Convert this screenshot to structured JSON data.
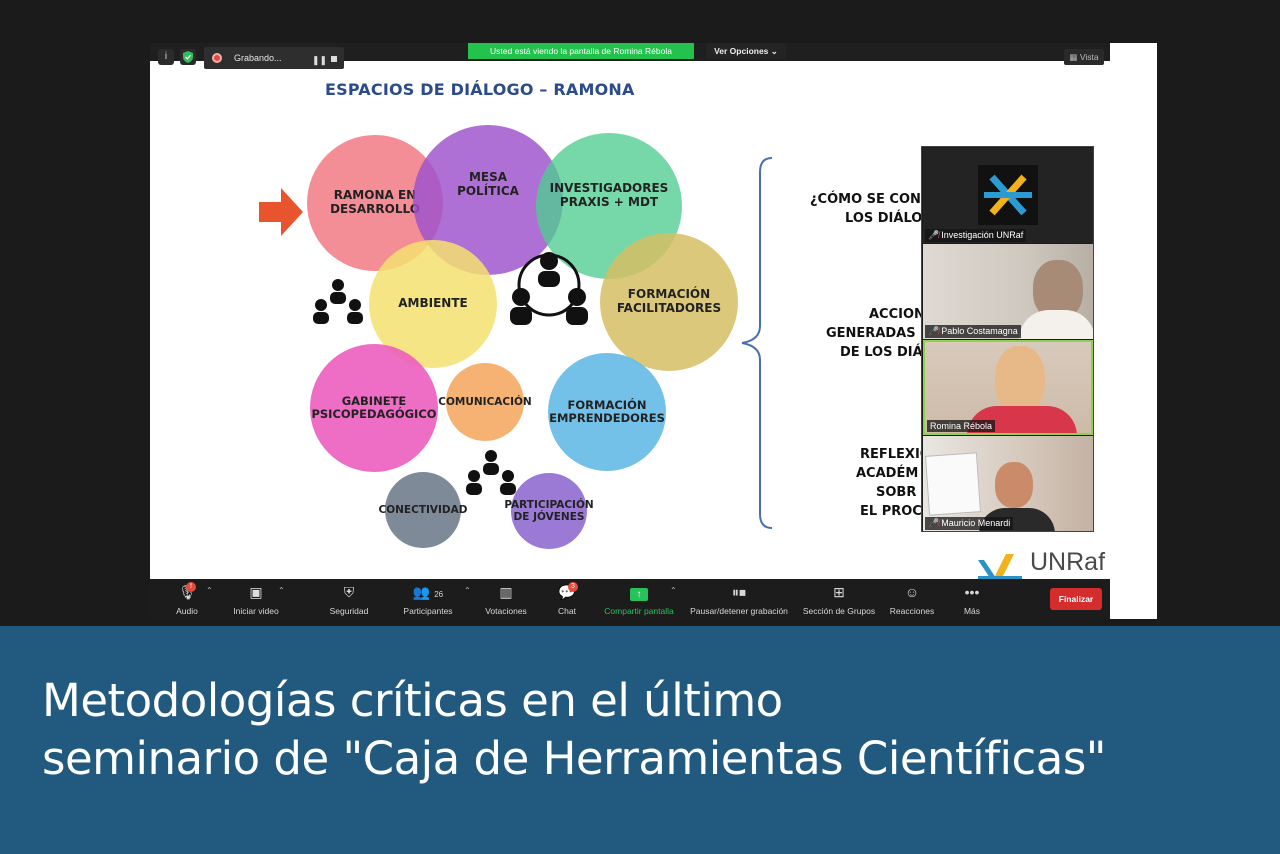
{
  "topbar": {
    "recording_label": "Grabando...",
    "share_banner": "Usted está viendo la pantalla de Romina Rébola",
    "options_label": "Ver Opciones",
    "view_label": "Vista"
  },
  "slide": {
    "title": "ESPACIOS DE DIÁLOGO – RAMONA",
    "circles": [
      {
        "label": "RAMONA EN DESARROLLO",
        "color": "#f07f86"
      },
      {
        "label": "MESA POLÍTICA",
        "color": "#a35bd0"
      },
      {
        "label": "INVESTIGADORES PRAXIS + MDT",
        "color": "#5fd199"
      },
      {
        "label": "AMBIENTE",
        "color": "#f4e080"
      },
      {
        "label": "FORMACIÓN FACILITADORES",
        "color": "#d7c06a"
      },
      {
        "label": "GABINETE PSICOPEDAGÓGICO",
        "color": "#ee6dc2"
      },
      {
        "label": "COMUNICACIÓN",
        "color": "#f6b06f"
      },
      {
        "label": "FORMACIÓN EMPRENDEDORES",
        "color": "#6dbde8"
      },
      {
        "label": "CONECTIVIDAD",
        "color": "#7d8896"
      },
      {
        "label": "PARTICIPACIÓN DE JÓVENES",
        "color": "#9b79d6"
      }
    ],
    "right_texts": {
      "block1": [
        "¿CÓMO SE CON",
        "LOS DIÁLO"
      ],
      "block2": [
        "ACCION",
        "GENERADAS",
        "DE LOS DIÁ"
      ],
      "block3": [
        "REFLEXIO",
        "ACADÉM",
        "SOBR",
        "EL PROC"
      ]
    },
    "logo_text": "UNRaf"
  },
  "participants": [
    {
      "name": "Investigación UNRaf",
      "muted": true
    },
    {
      "name": "Pablo Costamagna",
      "muted": true
    },
    {
      "name": "Romina Rébola",
      "muted": false
    },
    {
      "name": "Mauricio Menardi",
      "muted": true
    }
  ],
  "toolbar": {
    "audio": "Audio",
    "video": "Iniciar video",
    "security": "Seguridad",
    "participants": "Participantes",
    "participants_count": "26",
    "polls": "Votaciones",
    "chat": "Chat",
    "chat_badge": "3",
    "share": "Compartir pantalla",
    "record": "Pausar/detener grabación",
    "breakout": "Sección de Grupos",
    "reactions": "Reacciones",
    "more": "Más",
    "end": "Finalizar",
    "audio_badge": "!"
  },
  "caption": {
    "line1": "Metodologías críticas en el último",
    "line2": "seminario de \"Caja de Herramientas Científicas\""
  }
}
